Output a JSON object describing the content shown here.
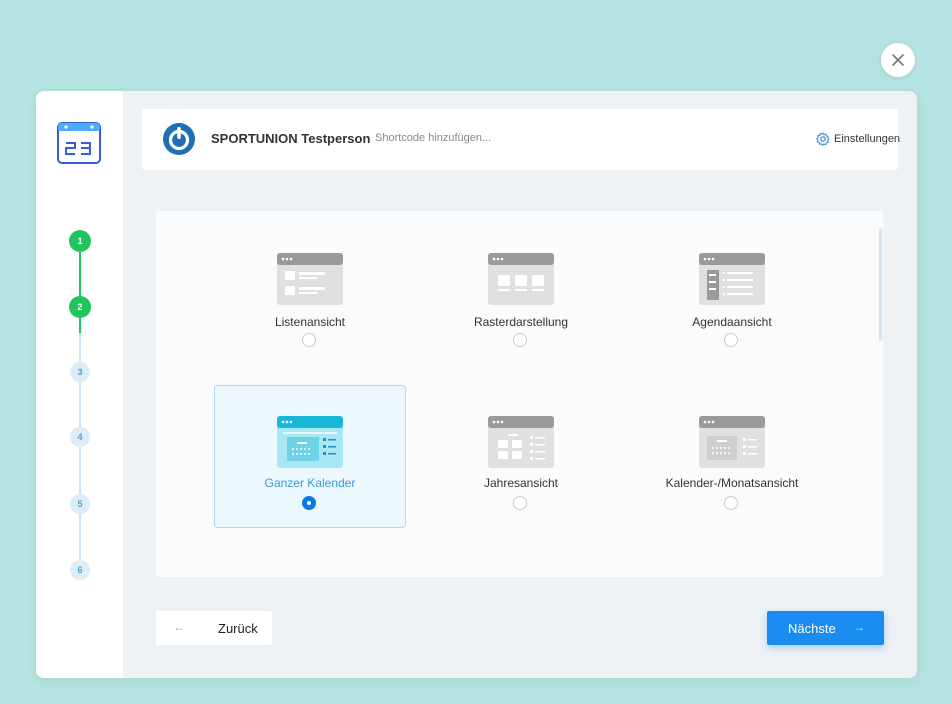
{
  "header": {
    "brand_name": "SPORTUNION Testperson",
    "shortcode_placeholder": "Shortcode hinzufügen...",
    "settings_label": "Einstellungen"
  },
  "steps": [
    {
      "number": "1",
      "state": "done"
    },
    {
      "number": "2",
      "state": "done"
    },
    {
      "number": "3",
      "state": "todo"
    },
    {
      "number": "4",
      "state": "todo"
    },
    {
      "number": "5",
      "state": "todo"
    },
    {
      "number": "6",
      "state": "todo"
    }
  ],
  "options": [
    {
      "label": "Listenansicht",
      "icon": "list-view-icon",
      "selected": false
    },
    {
      "label": "Rasterdarstellung",
      "icon": "grid-view-icon",
      "selected": false
    },
    {
      "label": "Agendaansicht",
      "icon": "agenda-view-icon",
      "selected": false
    },
    {
      "label": "Ganzer Kalender",
      "icon": "full-calendar-icon",
      "selected": true
    },
    {
      "label": "Jahresansicht",
      "icon": "year-view-icon",
      "selected": false
    },
    {
      "label": "Kalender-/Monatsansicht",
      "icon": "month-view-icon",
      "selected": false
    }
  ],
  "footer": {
    "back_label": "Zurück",
    "back_arrow": "←",
    "next_label": "Nächste",
    "next_arrow": "→"
  },
  "colors": {
    "background": "#b5e3e1",
    "step_done": "#21c55d",
    "step_todo": "#dcedf8",
    "accent_blue": "#1a8cf0",
    "selected_border": "#a7dcf2"
  }
}
